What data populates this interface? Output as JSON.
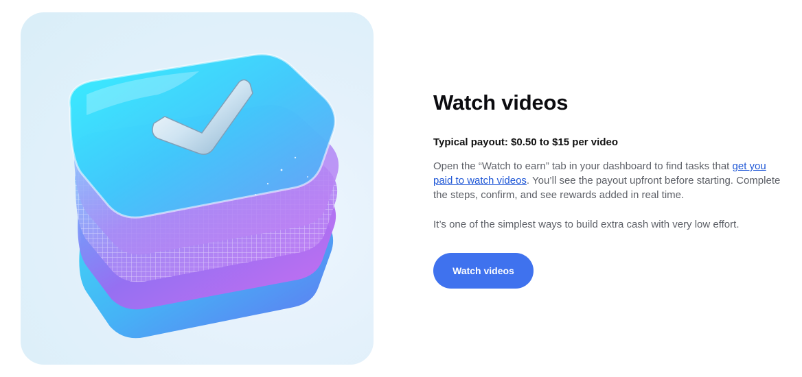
{
  "hero_image": {
    "icon": "layered-checkmark-illustration",
    "card_bg": "#e4f1fb",
    "colors": {
      "cyan": "#22e3f5",
      "violet": "#b07cf5",
      "magenta": "#c06df0",
      "blue": "#4a8cf5"
    }
  },
  "section": {
    "title": "Watch videos",
    "payout_label": "Typical payout: $0.50 to $15 per video",
    "description_before_link": "Open the “Watch to earn” tab in your dashboard to find tasks that ",
    "description_link": "get you paid to watch videos",
    "description_after_link": ". You’ll see the payout upfront before starting. Complete the steps, confirm, and see rewards added in real time.",
    "description_secondary": "It’s one of the simplest ways to build extra cash with very low effort.",
    "cta_label": "Watch videos",
    "cta_color": "#3f72ee",
    "link_color": "#1f57d6"
  }
}
